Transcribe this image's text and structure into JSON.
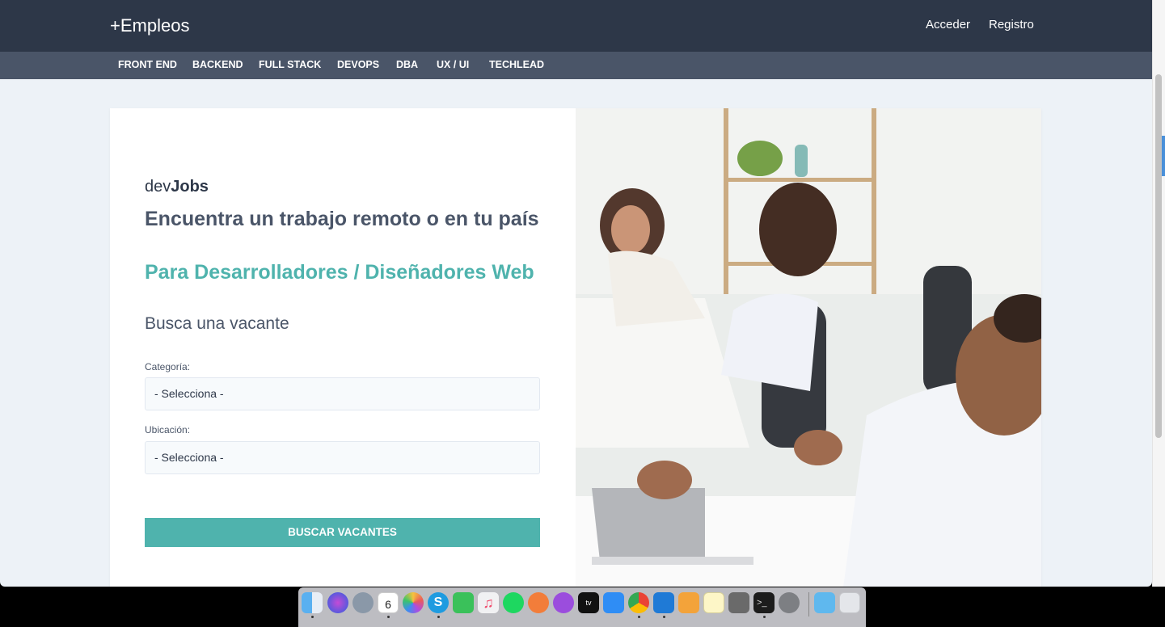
{
  "nav": {
    "brand": "+Empleos",
    "login": "Acceder",
    "register": "Registro"
  },
  "categories": [
    "FRONT END",
    "BACKEND",
    "FULL STACK",
    "DEVOPS",
    "DBA",
    "UX / UI",
    "TECHLEAD"
  ],
  "hero": {
    "logo_prefix": "dev",
    "logo_bold": "Jobs",
    "headline": "Encuentra un trabajo remoto o en tu país",
    "subheadline": "Para Desarrolladores / Diseñadores Web",
    "search_title": "Busca una vacante"
  },
  "form": {
    "category_label": "Categoría:",
    "category_value": "- Selecciona -",
    "location_label": "Ubicación:",
    "location_value": "- Selecciona -",
    "submit": "BUSCAR VACANTES"
  },
  "dock": {
    "apps": [
      "finder-icon",
      "siri-icon",
      "launchpad-icon",
      "calendar-icon",
      "photos-icon",
      "skype-icon",
      "facetime-icon",
      "music-icon",
      "spotify-icon",
      "swift-icon",
      "podcasts-icon",
      "appletv-icon",
      "appstore-icon",
      "chrome-icon",
      "vscode-icon",
      "sequel-icon",
      "notes-icon",
      "calculator-icon",
      "terminal-icon",
      "system-preferences-icon",
      "downloads-folder-icon",
      "trash-icon"
    ],
    "calendar_day": "6",
    "calendar_month": "DIC"
  },
  "colors": {
    "dark_nav": "#2d3748",
    "cat_nav": "#4a5568",
    "accent": "#4fb3ad",
    "page_bg": "#edf2f7"
  }
}
